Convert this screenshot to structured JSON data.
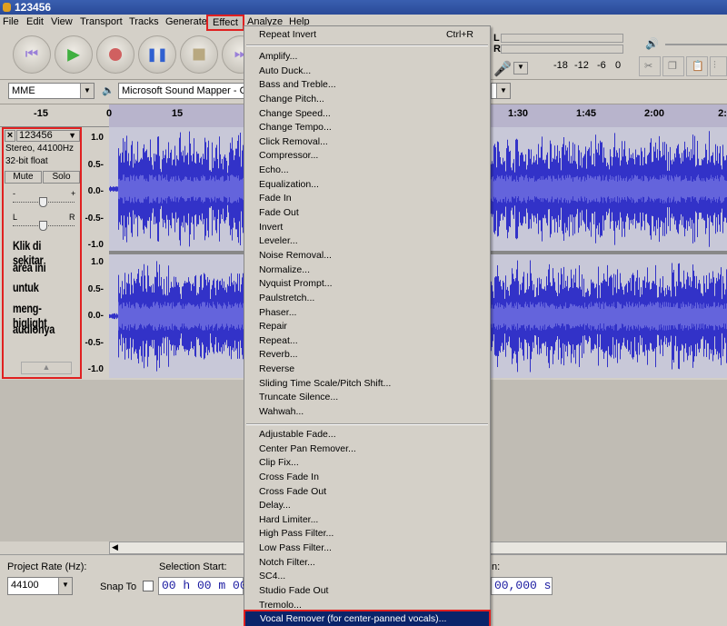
{
  "window": {
    "title": "123456"
  },
  "menubar": [
    "File",
    "Edit",
    "View",
    "Transport",
    "Tracks",
    "Generate",
    "Effect",
    "Analyze",
    "Help"
  ],
  "transport": {
    "buttons": [
      "skip-start",
      "play",
      "record",
      "pause",
      "stop",
      "skip-end"
    ]
  },
  "device": {
    "host": "MME",
    "output": "Microsoft Sound Mapper - Out"
  },
  "meter": {
    "l": "L",
    "r": "R",
    "ticks": [
      "-18",
      "-12",
      "-6",
      "0"
    ]
  },
  "ruler": {
    "labels": [
      {
        "t": "-15",
        "s": -15
      },
      {
        "t": "0",
        "s": 0
      },
      {
        "t": "15",
        "s": 15
      },
      {
        "t": "1:30",
        "s": 90
      },
      {
        "t": "1:45",
        "s": 105
      },
      {
        "t": "2:00",
        "s": 120
      },
      {
        "t": "2:",
        "s": 135
      }
    ]
  },
  "track": {
    "name": "123456",
    "info1": "Stereo, 44100Hz",
    "info2": "32-bit float",
    "mute": "Mute",
    "solo": "Solo",
    "gain_minus": "-",
    "gain_plus": "+",
    "pan_l": "L",
    "pan_r": "R",
    "scale": [
      "1.0",
      "0.5-",
      "0.0-",
      "-0.5-",
      "-1.0"
    ]
  },
  "annotation": [
    "Klik di sekitar",
    "area ini",
    "untuk",
    "meng-higlight",
    "audionya"
  ],
  "effect_menu": {
    "top": {
      "label": "Repeat Invert",
      "shortcut": "Ctrl+R"
    },
    "group1": [
      "Amplify...",
      "Auto Duck...",
      "Bass and Treble...",
      "Change Pitch...",
      "Change Speed...",
      "Change Tempo...",
      "Click Removal...",
      "Compressor...",
      "Echo...",
      "Equalization...",
      "Fade In",
      "Fade Out",
      "Invert",
      "Leveler...",
      "Noise Removal...",
      "Normalize...",
      "Nyquist Prompt...",
      "Paulstretch...",
      "Phaser...",
      "Repair",
      "Repeat...",
      "Reverb...",
      "Reverse",
      "Sliding Time Scale/Pitch Shift...",
      "Truncate Silence...",
      "Wahwah..."
    ],
    "group2": [
      "Adjustable Fade...",
      "Center Pan Remover...",
      "Clip Fix...",
      "Cross Fade In",
      "Cross Fade Out",
      "Delay...",
      "Hard Limiter...",
      "High Pass Filter...",
      "Low Pass Filter...",
      "Notch Filter...",
      "SC4...",
      "Studio Fade Out",
      "Tremolo...",
      "Vocal Remover (for center-panned vocals)..."
    ],
    "highlighted": "Vocal Remover (for center-panned vocals)..."
  },
  "bottom": {
    "project_rate_label": "Project Rate (Hz):",
    "project_rate": "44100",
    "snap_to": "Snap To",
    "selection_start_label": "Selection Start:",
    "selection_start": "00 h 00 m 00.",
    "end_label": "n:",
    "end_value": "00,000 s"
  },
  "colors": {
    "wave": "#3232c8",
    "highlight": "#0a246a",
    "annotation_box": "#e02020"
  }
}
